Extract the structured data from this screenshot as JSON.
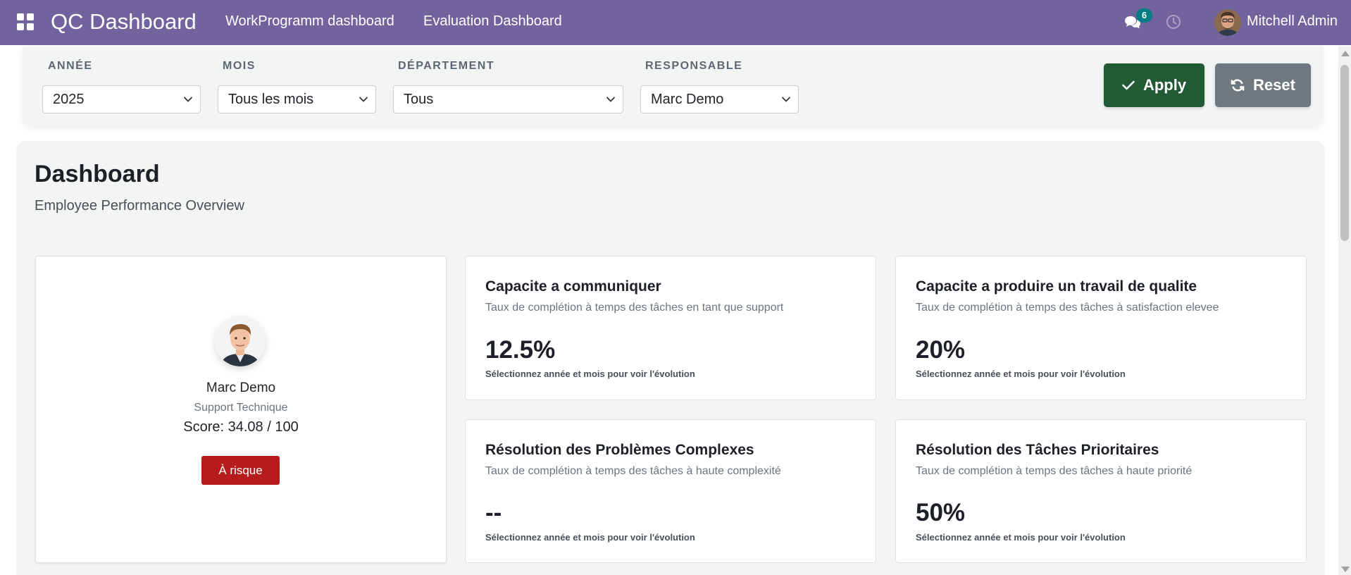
{
  "navbar": {
    "brand": "QC Dashboard",
    "links": [
      "WorkProgramm dashboard",
      "Evaluation Dashboard"
    ],
    "chat_count": "6",
    "user_name": "Mitchell Admin",
    "bg_color": "#71639e"
  },
  "filters": {
    "year": {
      "label": "ANNÉE",
      "value": "2025"
    },
    "month": {
      "label": "MOIS",
      "value": "Tous les mois"
    },
    "department": {
      "label": "DÉPARTEMENT",
      "value": "Tous"
    },
    "manager": {
      "label": "RESPONSABLE",
      "value": "Marc Demo"
    },
    "apply_label": "Apply",
    "reset_label": "Reset",
    "apply_color": "#235a36",
    "reset_color": "#6f7880"
  },
  "dashboard": {
    "title": "Dashboard",
    "subtitle": "Employee Performance Overview"
  },
  "profile": {
    "name": "Marc Demo",
    "role": "Support Technique",
    "score": "Score: 34.08 / 100",
    "status": "À risque",
    "status_color": "#b71c1c"
  },
  "metrics": [
    {
      "title": "Capacite a communiquer",
      "desc": "Taux de complétion à temps des tâches en tant que support",
      "value": "12.5%",
      "hint": "Sélectionnez année et mois pour voir l'évolution"
    },
    {
      "title": "Capacite a produire un travail de qualite",
      "desc": "Taux de complétion à temps des tâches à satisfaction elevee",
      "value": "20%",
      "hint": "Sélectionnez année et mois pour voir l'évolution"
    },
    {
      "title": "Résolution des Problèmes Complexes",
      "desc": "Taux de complétion à temps des tâches à haute complexité",
      "value": "--",
      "hint": "Sélectionnez année et mois pour voir l'évolution"
    },
    {
      "title": "Résolution des Tâches Prioritaires",
      "desc": "Taux de complétion à temps des tâches à haute priorité",
      "value": "50%",
      "hint": "Sélectionnez année et mois pour voir l'évolution"
    }
  ]
}
